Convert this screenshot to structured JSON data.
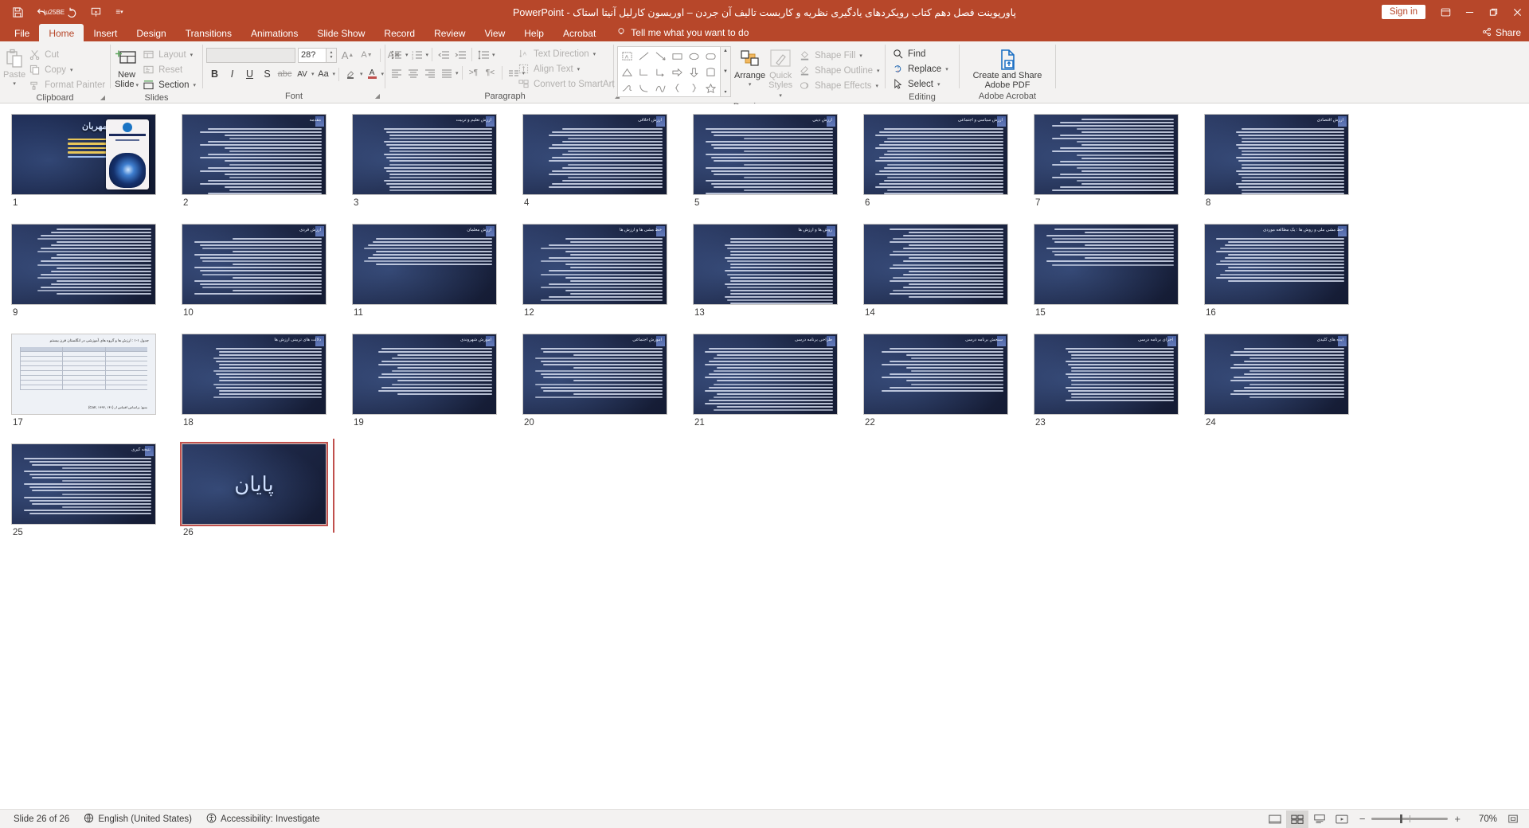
{
  "titlebar": {
    "app_name": "PowerPoint",
    "document_title": "پاورپوینت فصل دهم کتاب رویکردهای یادگیری نظریه و کاربست تالیف آن جردن – اوریسون کارلیل آنیتا استاک",
    "separator": "-",
    "signin_label": "Sign in",
    "quick_access": [
      {
        "name": "save-icon",
        "glyph": "💾"
      },
      {
        "name": "undo-icon",
        "glyph": "↶"
      },
      {
        "name": "redo-icon",
        "glyph": "↷"
      },
      {
        "name": "start-presentation-icon",
        "glyph": "▣"
      },
      {
        "name": "customize-qat-icon",
        "glyph": "▾"
      }
    ],
    "window_controls": [
      {
        "name": "ribbon-display-options-icon",
        "glyph": "⬜"
      },
      {
        "name": "minimize-icon",
        "glyph": "─"
      },
      {
        "name": "restore-icon",
        "glyph": "❐"
      },
      {
        "name": "close-icon",
        "glyph": "✕"
      }
    ]
  },
  "tabs": [
    {
      "id": "file",
      "label": "File",
      "active": false
    },
    {
      "id": "home",
      "label": "Home",
      "active": true
    },
    {
      "id": "insert",
      "label": "Insert",
      "active": false
    },
    {
      "id": "design",
      "label": "Design",
      "active": false
    },
    {
      "id": "transitions",
      "label": "Transitions",
      "active": false
    },
    {
      "id": "animations",
      "label": "Animations",
      "active": false
    },
    {
      "id": "slideshow",
      "label": "Slide Show",
      "active": false
    },
    {
      "id": "record",
      "label": "Record",
      "active": false
    },
    {
      "id": "review",
      "label": "Review",
      "active": false
    },
    {
      "id": "view",
      "label": "View",
      "active": false
    },
    {
      "id": "help",
      "label": "Help",
      "active": false
    },
    {
      "id": "acrobat",
      "label": "Acrobat",
      "active": false
    }
  ],
  "tellme": {
    "label": "Tell me what you want to do"
  },
  "share": {
    "label": "Share"
  },
  "ribbon": {
    "clipboard": {
      "group_label": "Clipboard",
      "paste_label": "Paste",
      "cut_label": "Cut",
      "copy_label": "Copy",
      "format_painter_label": "Format Painter"
    },
    "slides": {
      "group_label": "Slides",
      "new_slide_label_1": "New",
      "new_slide_label_2": "Slide",
      "layout_label": "Layout",
      "reset_label": "Reset",
      "section_label": "Section"
    },
    "font": {
      "group_label": "Font",
      "font_name_value": "",
      "font_size_value": "28?",
      "bold_label": "B",
      "italic_label": "I",
      "underline_label": "U",
      "strikethrough_label": "S",
      "text_shadow_label": "AV",
      "char_spacing_label": "AV",
      "change_case_label": "Aa",
      "grow_font_label": "A",
      "shrink_font_label": "A",
      "clear_formatting_label": "A"
    },
    "paragraph": {
      "group_label": "Paragraph",
      "text_direction_label": "Text Direction",
      "align_text_label": "Align Text",
      "convert_smartart_label": "Convert to SmartArt"
    },
    "drawing": {
      "group_label": "Drawing",
      "arrange_label": "Arrange",
      "quick_styles_label_1": "Quick",
      "quick_styles_label_2": "Styles",
      "shape_fill_label": "Shape Fill",
      "shape_outline_label": "Shape Outline",
      "shape_effects_label": "Shape Effects"
    },
    "editing": {
      "group_label": "Editing",
      "find_label": "Find",
      "replace_label": "Replace",
      "select_label": "Select"
    },
    "adobe": {
      "group_label": "Adobe Acrobat",
      "create_share_label_1": "Create and Share",
      "create_share_label_2": "Adobe PDF"
    }
  },
  "slides": [
    {
      "number": "1",
      "title": "بنام خداوند مهربان",
      "kind": "cover"
    },
    {
      "number": "2",
      "title": "مقدمه",
      "kind": "text",
      "lines": 22
    },
    {
      "number": "3",
      "title": "ارزش تعلیم و تربیت",
      "kind": "text",
      "lines": 20
    },
    {
      "number": "4",
      "title": "ارزش اخلاقی",
      "kind": "text",
      "lines": 19
    },
    {
      "number": "5",
      "title": "ارزش دینی",
      "kind": "text",
      "lines": 21
    },
    {
      "number": "6",
      "title": "ارزش سیاسی و اجتماعی",
      "kind": "text",
      "lines": 22
    },
    {
      "number": "7",
      "title": "",
      "kind": "text",
      "lines": 23
    },
    {
      "number": "8",
      "title": "ارزش اقتصادی",
      "kind": "text",
      "lines": 22
    },
    {
      "number": "9",
      "title": "",
      "kind": "text",
      "lines": 21
    },
    {
      "number": "10",
      "title": "ارزش فردی",
      "kind": "text",
      "lines": 18
    },
    {
      "number": "11",
      "title": "ارزش معلمان",
      "kind": "text",
      "lines": 9
    },
    {
      "number": "12",
      "title": "خط مشی ها و ارزش ها",
      "kind": "text",
      "lines": 20
    },
    {
      "number": "13",
      "title": "روش ها و ارزش ها",
      "kind": "text",
      "lines": 21
    },
    {
      "number": "14",
      "title": "",
      "kind": "text",
      "lines": 22
    },
    {
      "number": "15",
      "title": "",
      "kind": "text",
      "lines": 12
    },
    {
      "number": "16",
      "title": "خط مشی ملی و روش ها : یک مطالعه موردی",
      "kind": "text",
      "lines": 14
    },
    {
      "number": "17",
      "title": "جدول ۱-۱ : ارزش ها و گروه های آموزشی در انگلستان قرن بیستم",
      "kind": "table",
      "source": "منبع: براساس اقتباس از (۱۴۱ ,۱۹۹۴ ,Carr)"
    },
    {
      "number": "18",
      "title": "دلالت های تربیتی ارزش ها",
      "kind": "text",
      "lines": 16
    },
    {
      "number": "19",
      "title": "آموزش شهروندی",
      "kind": "text",
      "lines": 15
    },
    {
      "number": "20",
      "title": "آموزش اجتماعی",
      "kind": "text",
      "lines": 16
    },
    {
      "number": "21",
      "title": "طراحی برنامه درسی",
      "kind": "text",
      "lines": 20
    },
    {
      "number": "22",
      "title": "سنجش برنامه درسی",
      "kind": "text",
      "lines": 14
    },
    {
      "number": "23",
      "title": "اجرای برنامه درسی",
      "kind": "text",
      "lines": 17
    },
    {
      "number": "24",
      "title": "ایده های کلیدی",
      "kind": "text",
      "lines": 16
    },
    {
      "number": "25",
      "title": "نتیجه گیری",
      "kind": "text",
      "lines": 18
    },
    {
      "number": "26",
      "title": "پایان",
      "kind": "end",
      "selected": true
    }
  ],
  "status": {
    "slide_indicator": "Slide 26 of 26",
    "language": "English (United States)",
    "accessibility": "Accessibility: Investigate",
    "zoom_value": "70%",
    "views": [
      {
        "name": "reading-view-icon",
        "active": false
      },
      {
        "name": "slide-sorter-view-icon",
        "active": true
      },
      {
        "name": "notes-view-icon",
        "active": false
      },
      {
        "name": "slide-show-icon",
        "active": false
      }
    ]
  }
}
